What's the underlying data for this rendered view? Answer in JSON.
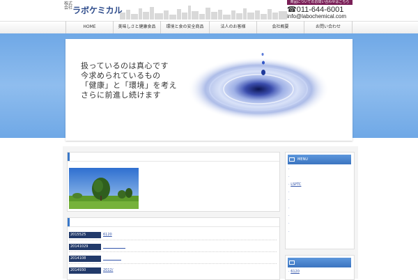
{
  "header": {
    "company_small": "株式\n会社",
    "company_name": "ラボケミカル",
    "inquiry_tab": "商品についてのお問い合わせはこちら",
    "phone": "☎011-644-6001",
    "email": "info@labochemical.com"
  },
  "nav": {
    "items": [
      {
        "label": "HOME"
      },
      {
        "label": "美味しさと健康食品"
      },
      {
        "label": "環境と食の安全商品"
      },
      {
        "label": "法人のお客様"
      },
      {
        "label": "会社概要"
      },
      {
        "label": "お問い合わせ"
      }
    ]
  },
  "hero": {
    "lines": [
      "扱っているのは真心です",
      "今求められているもの",
      "「健康」と「環境」を考え",
      "さらに前進し続けます"
    ]
  },
  "news": {
    "items": [
      {
        "date": "2015525",
        "title": "6120"
      },
      {
        "date": "20141029",
        "title": ""
      },
      {
        "date": "2014108",
        "title": ""
      },
      {
        "date": "2014930",
        "title": "2012/"
      }
    ]
  },
  "sidebar": {
    "menu_title": "MENU",
    "menu_items": [
      "",
      "",
      "LSPTC",
      "",
      "",
      "",
      "",
      "",
      ""
    ],
    "news_items": [
      "6120"
    ]
  },
  "colors": {
    "brand": "#2c4a8a",
    "accent_blue": "#3a78c8",
    "band_blue": "#8fbdee",
    "date_bg": "#223a6a",
    "inquiry_bg": "#7a1f57"
  }
}
